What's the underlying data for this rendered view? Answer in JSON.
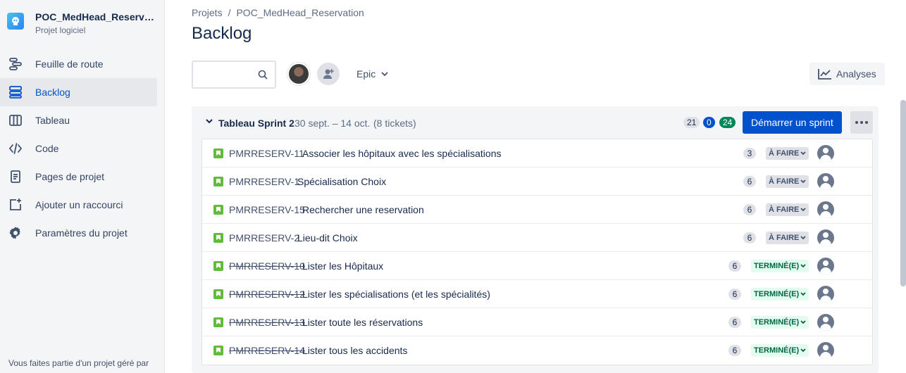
{
  "sidebar": {
    "project_name": "POC_MedHead_Reservation",
    "project_type": "Projet logiciel",
    "items": [
      {
        "label": "Feuille de route",
        "icon": "roadmap-icon"
      },
      {
        "label": "Backlog",
        "icon": "backlog-icon",
        "active": true
      },
      {
        "label": "Tableau",
        "icon": "board-icon"
      },
      {
        "label": "Code",
        "icon": "code-icon"
      },
      {
        "label": "Pages de projet",
        "icon": "pages-icon"
      },
      {
        "label": "Ajouter un raccourci",
        "icon": "add-shortcut-icon"
      },
      {
        "label": "Paramètres du projet",
        "icon": "settings-icon"
      }
    ],
    "footer": "Vous faites partie d'un projet géré par"
  },
  "breadcrumb": [
    "Projets",
    "/",
    "POC_MedHead_Reservation"
  ],
  "page_title": "Backlog",
  "toolbar": {
    "search_placeholder": "",
    "epic_label": "Epic",
    "analyses_label": "Analyses"
  },
  "sprint": {
    "name": "Tableau Sprint 2",
    "dates": "30 sept. – 14 oct.",
    "count": "(8 tickets)",
    "points_todo": "21",
    "points_progress": "0",
    "points_done": "24",
    "start_label": "Démarrer un sprint"
  },
  "issues": [
    {
      "key": "PMRRESERV-11",
      "summary": "Associer les hôpitaux avec les spécialisations",
      "points": "3",
      "status": "À FAIRE",
      "done": false
    },
    {
      "key": "PMRRESERV-1",
      "summary": "Spécialisation Choix",
      "points": "6",
      "status": "À FAIRE",
      "done": false
    },
    {
      "key": "PMRRESERV-15",
      "summary": "Rechercher une reservation",
      "points": "6",
      "status": "À FAIRE",
      "done": false
    },
    {
      "key": "PMRRESERV-2",
      "summary": "Lieu-dit Choix",
      "points": "6",
      "status": "À FAIRE",
      "done": false
    },
    {
      "key": "PMRRESERV-10",
      "summary": "Lister les Hôpitaux",
      "points": "6",
      "status": "TERMINÉ(E)",
      "done": true
    },
    {
      "key": "PMRRESERV-12",
      "summary": "Lister les spécialisations (et les spécialités)",
      "points": "6",
      "status": "TERMINÉ(E)",
      "done": true
    },
    {
      "key": "PMRRESERV-13",
      "summary": "Lister toute les réservations",
      "points": "6",
      "status": "TERMINÉ(E)",
      "done": true
    },
    {
      "key": "PMRRESERV-14",
      "summary": "Lister tous les accidents",
      "points": "6",
      "status": "TERMINÉ(E)",
      "done": true
    }
  ]
}
